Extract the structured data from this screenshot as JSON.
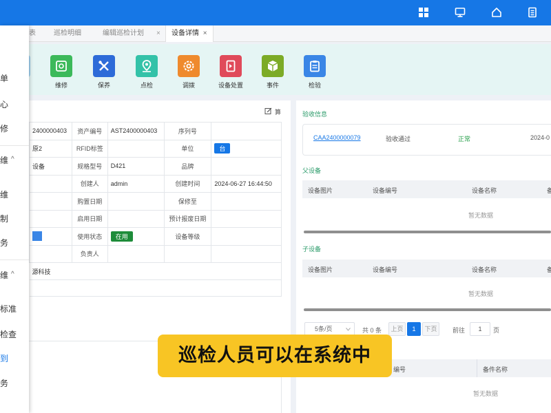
{
  "tabs": [
    {
      "label": "表",
      "active": false
    },
    {
      "label": "巡检明细",
      "active": false
    },
    {
      "label": "编辑巡检计划",
      "active": false
    },
    {
      "label": "设备详情",
      "active": true
    }
  ],
  "tab_close": "×",
  "sidebar": {
    "items": [
      "单",
      "心",
      "修",
      "维",
      "维",
      "制",
      "务",
      "维",
      "标准",
      "检查",
      "到",
      "务"
    ],
    "chevrons": [
      "^",
      "^"
    ]
  },
  "toolbar": [
    {
      "label": "维修",
      "icon": "repair-icon",
      "color": "#3cb95a"
    },
    {
      "label": "保养",
      "icon": "tools-icon",
      "color": "#2d6bd8"
    },
    {
      "label": "点检",
      "icon": "location-pin-icon",
      "color": "#33c2a8"
    },
    {
      "label": "调拨",
      "icon": "transfer-gear-icon",
      "color": "#ef8a2d"
    },
    {
      "label": "设备处置",
      "icon": "dispose-icon",
      "color": "#e04a5a"
    },
    {
      "label": "事件",
      "icon": "cube-icon",
      "color": "#7cab26"
    },
    {
      "label": "检验",
      "icon": "clipboard-icon",
      "color": "#3a86e6"
    }
  ],
  "left_panel": {
    "edit_label": "算",
    "rows": [
      [
        "2400000403",
        "资产编号",
        "AST2400000403",
        "序列号",
        ""
      ],
      [
        "原2",
        "RFID标签",
        "",
        "单位",
        "台"
      ],
      [
        "设备",
        "规格型号",
        "D421",
        "品牌",
        ""
      ],
      [
        "",
        "创建人",
        "admin",
        "创建时间",
        "2024-06-27 16:44:50"
      ],
      [
        "",
        "购置日期",
        "",
        "保修至",
        ""
      ],
      [
        "",
        "启用日期",
        "",
        "预计报废日期",
        ""
      ],
      [
        "",
        "使用状态",
        "在用",
        "设备等级",
        ""
      ],
      [
        "",
        "负责人",
        "",
        "",
        ""
      ]
    ],
    "extra_row": "源科技"
  },
  "right_panel": {
    "acceptance": {
      "title": "验收信息",
      "code": "CAA2400000079",
      "result": "验收通过",
      "status": "正常",
      "date": "2024-0"
    },
    "parent": {
      "title": "父设备",
      "headers": [
        "设备图片",
        "设备编号",
        "设备名称",
        "备"
      ],
      "empty": "暂无数据"
    },
    "child": {
      "title": "子设备",
      "headers": [
        "设备图片",
        "设备编号",
        "设备名称",
        "备"
      ],
      "empty": "暂无数据"
    },
    "pagination": {
      "page_size": "5条/页",
      "total": "共 0 条",
      "prev": "上页",
      "current": "1",
      "next": "下页",
      "goto": "前往",
      "goto_value": "1",
      "page_unit": "页"
    },
    "bottom_grid": {
      "headers": [
        "编号",
        "备件名称"
      ],
      "empty": "暂无数据"
    }
  },
  "caption": "巡检人员可以在系统中"
}
